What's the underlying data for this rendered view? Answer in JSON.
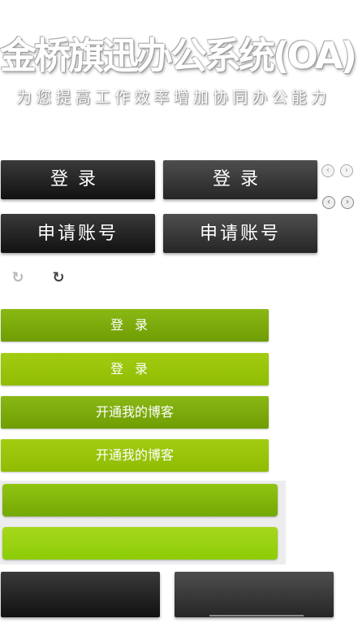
{
  "header": {
    "title": "金桥旗迅办公系统(OA)",
    "subtitle": "为您提高工作效率增加协同办公能力"
  },
  "dark_buttons": {
    "login_1": "登录",
    "login_2": "登录",
    "apply_1": "申请账号",
    "apply_2": "申请账号"
  },
  "icons": {
    "arrows": [
      "arrow-left-icon",
      "arrow-right-icon"
    ],
    "refresh": [
      "refresh-icon-light",
      "refresh-icon-dark"
    ],
    "arrow_glyphs": {
      "left": "‹",
      "right": "›"
    },
    "refresh_glyph": "↻"
  },
  "green_buttons": {
    "login_1": "登录",
    "login_2": "登录",
    "blog_1": "开通我的博客",
    "blog_2": "开通我的博客"
  },
  "colors": {
    "dark_button": "#1c1c1c",
    "dark_button_alt": "#3a3a3a",
    "green_dark": "#7aa80a",
    "green_light": "#98c40a",
    "green_big_light": "#96d010"
  }
}
